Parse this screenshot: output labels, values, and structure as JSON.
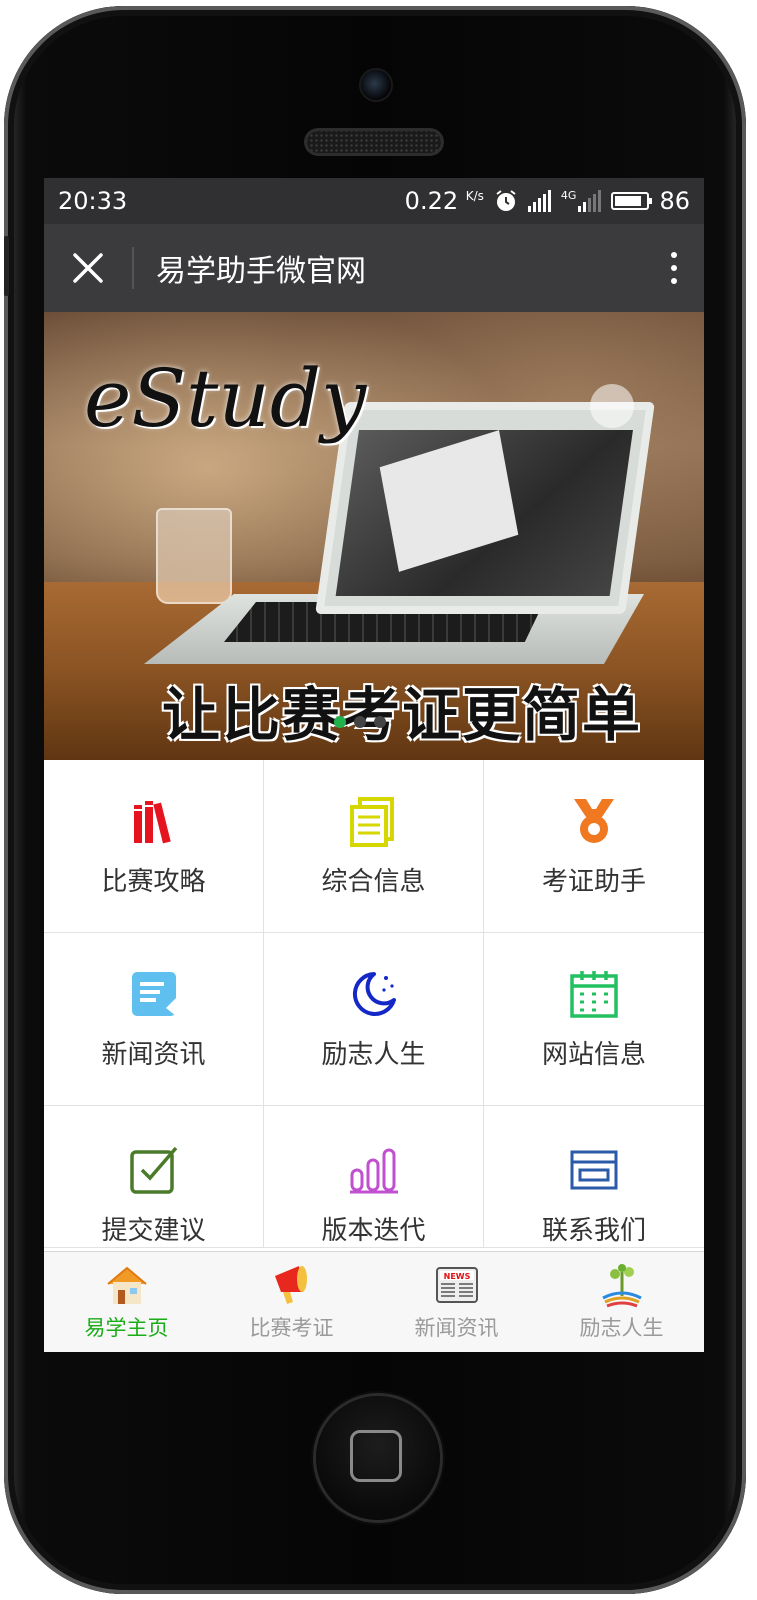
{
  "status_bar": {
    "time": "20:33",
    "net_speed": "0.22",
    "net_unit": "K/s",
    "network_type": "4G",
    "battery": "86"
  },
  "nav": {
    "title": "易学助手微官网",
    "close_icon": "close-icon",
    "more_icon": "more-vertical-icon"
  },
  "banner": {
    "logo_text": "eStudy",
    "slogan": "让比赛考证更简单",
    "slide_count": 3,
    "active_slide": 1
  },
  "grid": {
    "items": [
      {
        "label": "比赛攻略",
        "icon": "books-icon",
        "color": "#e6141e"
      },
      {
        "label": "综合信息",
        "icon": "document-icon",
        "color": "#d6d600"
      },
      {
        "label": "考证助手",
        "icon": "medal-icon",
        "color": "#f07820"
      },
      {
        "label": "新闻资讯",
        "icon": "news-card-icon",
        "color": "#5fc0f0"
      },
      {
        "label": "励志人生",
        "icon": "moon-icon",
        "color": "#1428c8"
      },
      {
        "label": "网站信息",
        "icon": "calendar-icon",
        "color": "#22c060"
      },
      {
        "label": "提交建议",
        "icon": "checkbox-icon",
        "color": "#4a7a2a"
      },
      {
        "label": "版本迭代",
        "icon": "bar-chart-icon",
        "color": "#c050d0"
      },
      {
        "label": "联系我们",
        "icon": "id-card-icon",
        "color": "#2a5aa8"
      }
    ]
  },
  "tabbar": {
    "items": [
      {
        "label": "易学主页",
        "icon": "home-icon",
        "active": true
      },
      {
        "label": "比赛考证",
        "icon": "megaphone-icon",
        "active": false
      },
      {
        "label": "新闻资讯",
        "icon": "newspaper-icon",
        "active": false,
        "badge_text": "NEWS"
      },
      {
        "label": "励志人生",
        "icon": "tree-icon",
        "active": false
      }
    ],
    "active_color": "#1aad19"
  }
}
